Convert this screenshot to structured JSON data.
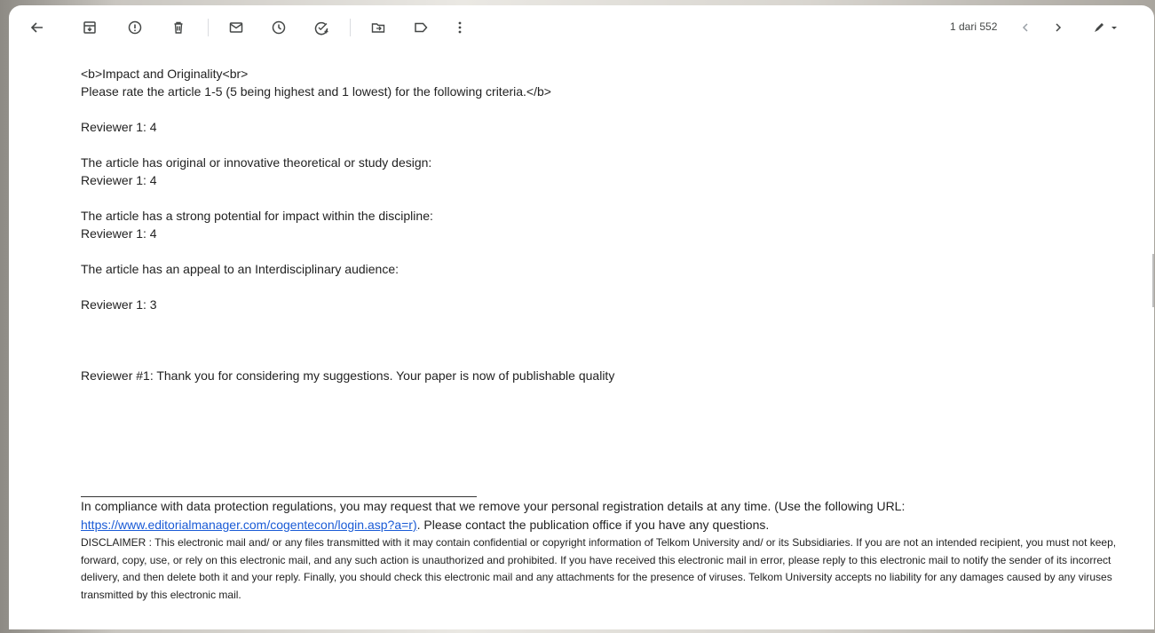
{
  "toolbar": {
    "icons": [
      "back-icon",
      "archive-icon",
      "report-spam-icon",
      "delete-icon",
      "mark-unread-icon",
      "snooze-icon",
      "add-task-icon",
      "move-to-icon",
      "label-icon",
      "more-icon"
    ],
    "counter": "1 dari 552",
    "prev_icon": "chevron-left-icon",
    "next_icon": "chevron-right-icon",
    "edit_icon": "pencil-icon"
  },
  "message": {
    "heading_line1": "<b>Impact and Originality<br>",
    "heading_line2": "Please rate the article 1-5 (5 being highest and 1 lowest) for the following criteria.</b>",
    "r1_score_a": "Reviewer 1: 4",
    "q_original": "The article has original or innovative theoretical or study design:",
    "r1_score_b": "Reviewer 1: 4",
    "q_impact": "The article has a strong potential for impact within the discipline:",
    "r1_score_c": "Reviewer 1: 4",
    "q_interdisciplinary": "The article has an appeal to an Interdisciplinary audience:",
    "r1_score_d": "Reviewer 1: 3",
    "reviewer_comment": "Reviewer #1: Thank you for considering my suggestions. Your paper is now of publishable quality"
  },
  "footer": {
    "compliance": "In compliance with data protection regulations, you may request that we remove your personal registration details at any time.  (Use the following URL:",
    "link": "https://www.editorialmanager.com/cogentecon/login.asp?a=r)",
    "contact": ". Please contact the publication office if you have any questions.",
    "disclaimer": "DISCLAIMER : This electronic mail and/ or any files transmitted with it may contain confidential or copyright information of Telkom University and/ or its Subsidiaries. If you are not an intended recipient, you must not keep, forward, copy, use, or rely on this electronic mail, and any such action is unauthorized and prohibited. If you have received this electronic mail in error, please reply to this electronic mail to notify the sender of its incorrect delivery, and then delete both it and your reply. Finally, you should check this electronic mail and any attachments for the presence of viruses. Telkom University accepts no liability for any damages caused by any viruses transmitted by this electronic mail."
  }
}
